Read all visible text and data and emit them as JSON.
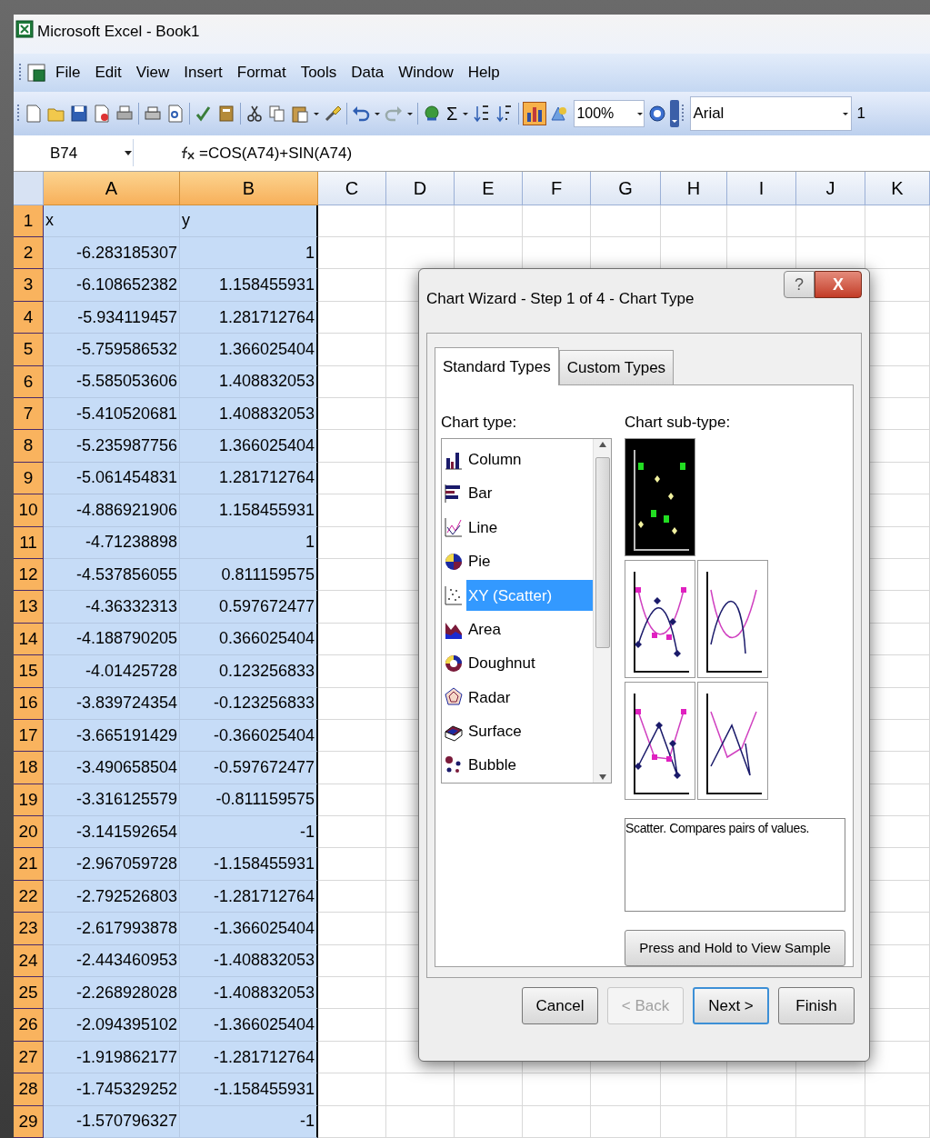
{
  "window": {
    "title": "Microsoft Excel - Book1"
  },
  "menu": [
    "File",
    "Edit",
    "View",
    "Insert",
    "Format",
    "Tools",
    "Data",
    "Window",
    "Help"
  ],
  "toolbar": {
    "sum": "Σ",
    "zoom": "100%",
    "font": "Arial",
    "font_size": "1"
  },
  "formula_bar": {
    "name_box": "B74",
    "formula": "=COS(A74)+SIN(A74)"
  },
  "columns": [
    {
      "label": "A",
      "selected": true
    },
    {
      "label": "B",
      "selected": true
    },
    {
      "label": "C",
      "selected": false
    },
    {
      "label": "D",
      "selected": false
    },
    {
      "label": "E",
      "selected": false
    },
    {
      "label": "F",
      "selected": false
    },
    {
      "label": "G",
      "selected": false
    },
    {
      "label": "H",
      "selected": false
    },
    {
      "label": "I",
      "selected": false
    },
    {
      "label": "J",
      "selected": false
    },
    {
      "label": "K",
      "selected": false
    }
  ],
  "rows": [
    {
      "number": "1",
      "selected": true,
      "kind": "text",
      "cells": [
        "x",
        "y"
      ]
    },
    {
      "number": "2",
      "selected": true,
      "kind": "number",
      "cells": [
        "-6.283185307",
        "1"
      ]
    },
    {
      "number": "3",
      "selected": true,
      "kind": "number",
      "cells": [
        "-6.108652382",
        "1.158455931"
      ]
    },
    {
      "number": "4",
      "selected": true,
      "kind": "number",
      "cells": [
        "-5.934119457",
        "1.281712764"
      ]
    },
    {
      "number": "5",
      "selected": true,
      "kind": "number",
      "cells": [
        "-5.759586532",
        "1.366025404"
      ]
    },
    {
      "number": "6",
      "selected": true,
      "kind": "number",
      "cells": [
        "-5.585053606",
        "1.408832053"
      ]
    },
    {
      "number": "7",
      "selected": true,
      "kind": "number",
      "cells": [
        "-5.410520681",
        "1.408832053"
      ]
    },
    {
      "number": "8",
      "selected": true,
      "kind": "number",
      "cells": [
        "-5.235987756",
        "1.366025404"
      ]
    },
    {
      "number": "9",
      "selected": true,
      "kind": "number",
      "cells": [
        "-5.061454831",
        "1.281712764"
      ]
    },
    {
      "number": "10",
      "selected": true,
      "kind": "number",
      "cells": [
        "-4.886921906",
        "1.158455931"
      ]
    },
    {
      "number": "11",
      "selected": true,
      "kind": "number",
      "cells": [
        "-4.71238898",
        "1"
      ]
    },
    {
      "number": "12",
      "selected": true,
      "kind": "number",
      "cells": [
        "-4.537856055",
        "0.811159575"
      ]
    },
    {
      "number": "13",
      "selected": true,
      "kind": "number",
      "cells": [
        "-4.36332313",
        "0.597672477"
      ]
    },
    {
      "number": "14",
      "selected": true,
      "kind": "number",
      "cells": [
        "-4.188790205",
        "0.366025404"
      ]
    },
    {
      "number": "15",
      "selected": true,
      "kind": "number",
      "cells": [
        "-4.01425728",
        "0.123256833"
      ]
    },
    {
      "number": "16",
      "selected": true,
      "kind": "number",
      "cells": [
        "-3.839724354",
        "-0.123256833"
      ]
    },
    {
      "number": "17",
      "selected": true,
      "kind": "number",
      "cells": [
        "-3.665191429",
        "-0.366025404"
      ]
    },
    {
      "number": "18",
      "selected": true,
      "kind": "number",
      "cells": [
        "-3.490658504",
        "-0.597672477"
      ]
    },
    {
      "number": "19",
      "selected": true,
      "kind": "number",
      "cells": [
        "-3.316125579",
        "-0.811159575"
      ]
    },
    {
      "number": "20",
      "selected": true,
      "kind": "number",
      "cells": [
        "-3.141592654",
        "-1"
      ]
    },
    {
      "number": "21",
      "selected": true,
      "kind": "number",
      "cells": [
        "-2.967059728",
        "-1.158455931"
      ]
    },
    {
      "number": "22",
      "selected": true,
      "kind": "number",
      "cells": [
        "-2.792526803",
        "-1.281712764"
      ]
    },
    {
      "number": "23",
      "selected": true,
      "kind": "number",
      "cells": [
        "-2.617993878",
        "-1.366025404"
      ]
    },
    {
      "number": "24",
      "selected": true,
      "kind": "number",
      "cells": [
        "-2.443460953",
        "-1.408832053"
      ]
    },
    {
      "number": "25",
      "selected": true,
      "kind": "number",
      "cells": [
        "-2.268928028",
        "-1.408832053"
      ]
    },
    {
      "number": "26",
      "selected": true,
      "kind": "number",
      "cells": [
        "-2.094395102",
        "-1.366025404"
      ]
    },
    {
      "number": "27",
      "selected": true,
      "kind": "number",
      "cells": [
        "-1.919862177",
        "-1.281712764"
      ]
    },
    {
      "number": "28",
      "selected": true,
      "kind": "number",
      "cells": [
        "-1.745329252",
        "-1.158455931"
      ]
    },
    {
      "number": "29",
      "selected": true,
      "kind": "number",
      "cells": [
        "-1.570796327",
        "-1"
      ]
    }
  ],
  "dialog": {
    "title": "Chart Wizard - Step 1 of 4 - Chart Type",
    "help_button": "?",
    "close_button": "X",
    "tabs": [
      {
        "label": "Standard Types",
        "selected": true
      },
      {
        "label": "Custom Types",
        "selected": false
      }
    ],
    "chart_type_label": "Chart type:",
    "chart_types": [
      {
        "label": "Column",
        "selected": false
      },
      {
        "label": "Bar",
        "selected": false
      },
      {
        "label": "Line",
        "selected": false
      },
      {
        "label": "Pie",
        "selected": false
      },
      {
        "label": "XY (Scatter)",
        "selected": true
      },
      {
        "label": "Area",
        "selected": false
      },
      {
        "label": "Doughnut",
        "selected": false
      },
      {
        "label": "Radar",
        "selected": false
      },
      {
        "label": "Surface",
        "selected": false
      },
      {
        "label": "Bubble",
        "selected": false
      }
    ],
    "subtype_label": "Chart sub-type:",
    "subtypes": [
      {
        "selected": true
      },
      {
        "selected": false
      },
      {
        "selected": false
      },
      {
        "selected": false
      },
      {
        "selected": false
      }
    ],
    "description": "Scatter. Compares pairs of values.",
    "sample_button": "Press and Hold to View Sample",
    "buttons": [
      {
        "label": "Cancel",
        "disabled": false,
        "default": false
      },
      {
        "label": "< Back",
        "disabled": true,
        "default": false
      },
      {
        "label": "Next >",
        "disabled": false,
        "default": true
      },
      {
        "label": "Finish",
        "disabled": false,
        "default": false
      }
    ]
  }
}
